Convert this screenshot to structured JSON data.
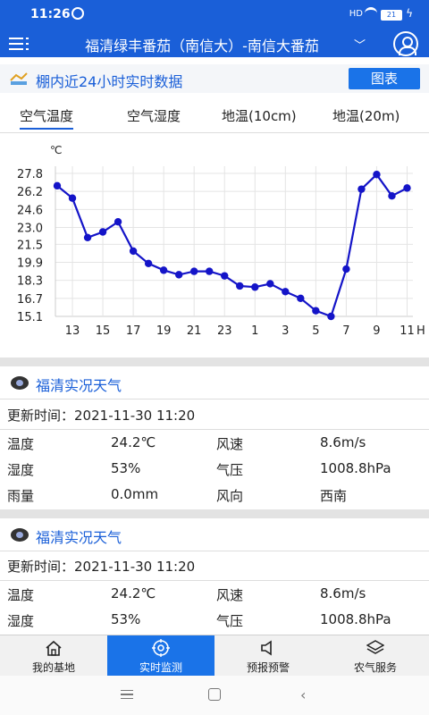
{
  "status": {
    "time": "11:26",
    "signal": "HD",
    "battery": "21"
  },
  "header": {
    "title": "福清绿丰番茄（南信大）-南信大番茄"
  },
  "section": {
    "label": "棚内近24小时实时数据",
    "chart_button": "图表"
  },
  "tabs": [
    {
      "label": "空气温度",
      "active": true
    },
    {
      "label": "空气湿度",
      "active": false
    },
    {
      "label": "地温(10cm)",
      "active": false
    },
    {
      "label": "地温(20m)",
      "active": false
    }
  ],
  "chart_data": {
    "type": "line",
    "ylabel": "℃",
    "xlabel_suffix": "H",
    "yticks": [
      "27.8",
      "26.2",
      "24.6",
      "23.0",
      "21.5",
      "19.9",
      "18.3",
      "16.7",
      "15.1"
    ],
    "ylim": [
      15.1,
      27.8
    ],
    "xticks": [
      "13",
      "15",
      "17",
      "19",
      "21",
      "23",
      "1",
      "3",
      "5",
      "7",
      "9",
      "11"
    ],
    "series": [
      {
        "values": [
          26.7,
          25.6,
          22.1,
          22.6,
          23.5,
          20.9,
          19.8,
          19.2,
          18.8,
          19.1,
          19.1,
          18.7,
          17.8,
          17.7,
          18.0,
          17.3,
          16.7,
          15.6,
          15.1,
          19.3,
          26.4,
          27.7,
          25.8,
          26.5
        ]
      }
    ],
    "line_color": "#1414c8"
  },
  "weather": [
    {
      "title": "福清实况天气",
      "update_label": "更新时间：",
      "update_time": "2021-11-30 11:20",
      "rows": [
        {
          "k1": "温度",
          "v1": "24.2℃",
          "k2": "风速",
          "v2": "8.6m/s"
        },
        {
          "k1": "湿度",
          "v1": "53%",
          "k2": "气压",
          "v2": "1008.8hPa"
        },
        {
          "k1": "雨量",
          "v1": "0.0mm",
          "k2": "风向",
          "v2": "西南"
        }
      ]
    },
    {
      "title": "福清实况天气",
      "update_label": "更新时间：",
      "update_time": "2021-11-30 11:20",
      "rows": [
        {
          "k1": "温度",
          "v1": "24.2℃",
          "k2": "风速",
          "v2": "8.6m/s"
        },
        {
          "k1": "湿度",
          "v1": "53%",
          "k2": "气压",
          "v2": "1008.8hPa"
        }
      ]
    }
  ],
  "nav": [
    {
      "label": "我的基地",
      "icon": "home-icon",
      "active": false
    },
    {
      "label": "实时监测",
      "icon": "target-icon",
      "active": true
    },
    {
      "label": "预报预警",
      "icon": "speaker-icon",
      "active": false
    },
    {
      "label": "农气服务",
      "icon": "layers-icon",
      "active": false
    }
  ],
  "colors": {
    "primary": "#1a5fd8",
    "accent": "#1a73e8"
  }
}
